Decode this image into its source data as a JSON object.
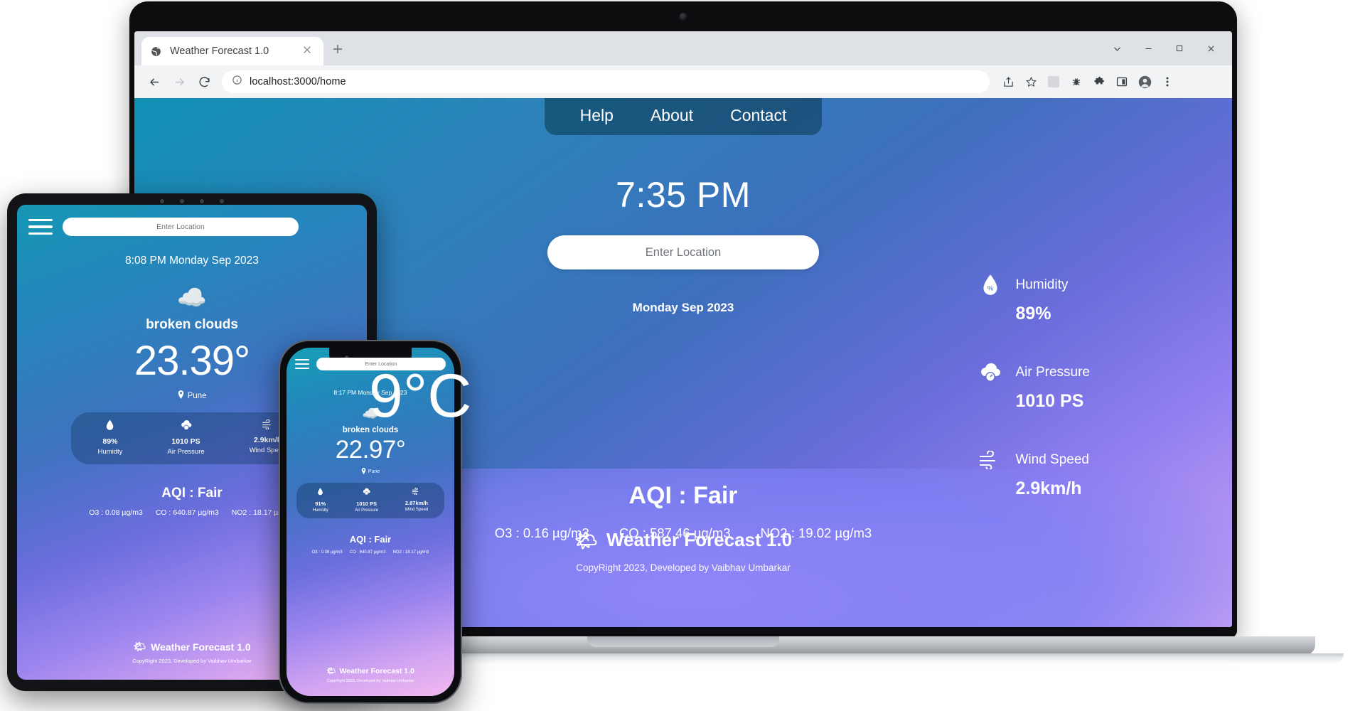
{
  "browser": {
    "tab": {
      "title": "Weather Forecast 1.0",
      "favicon": "globe-icon",
      "close": "×"
    },
    "new_tab": "+",
    "window_controls": {
      "minimize": "—",
      "maximize": "□",
      "close": "✕",
      "chevron_down": "⌄"
    },
    "nav": {
      "back": "←",
      "forward": "→",
      "reload": "⟳"
    },
    "omnibox": {
      "info_icon": "info-circle-icon",
      "url": "localhost:3000/home"
    },
    "toolbar_icons": [
      "share-icon",
      "star-icon",
      "qr-code-icon",
      "bug-icon",
      "extensions-icon",
      "split-screen-icon",
      "avatar-icon",
      "more-menu-icon"
    ]
  },
  "desktop": {
    "nav": [
      {
        "label": "Help"
      },
      {
        "label": "About"
      },
      {
        "label": "Contact"
      }
    ],
    "time": "7:35 PM",
    "search": {
      "placeholder": "Enter Location",
      "value": ""
    },
    "date": "Monday Sep 2023",
    "temperature": "9°C",
    "metrics": [
      {
        "icon": "humidity-droplet-icon",
        "label": "Humidity",
        "value": "89%"
      },
      {
        "icon": "air-pressure-cloud-gauge-icon",
        "label": "Air Pressure",
        "value": "1010 PS"
      },
      {
        "icon": "wind-speed-icon",
        "label": "Wind Speed",
        "value": "2.9km/h"
      }
    ],
    "aqi": {
      "title": "AQI : Fair",
      "pollutants": [
        "O3 : 0.16 µg/m3",
        "CO : 587.46 µg/m3",
        "NO2 : 19.02 µg/m3"
      ]
    },
    "footer": {
      "emoji": "🌤",
      "brand": "Weather Forecast 1.0",
      "copyright": "CopyRight 2023, Developed by Vaibhav Umbarkar"
    }
  },
  "tablet": {
    "menu_icon": "hamburger-menu-icon",
    "search": {
      "placeholder": "Enter Location",
      "value": ""
    },
    "datetime": "8:08 PM  Monday Sep 2023",
    "weather_icon": "broken-clouds-icon",
    "condition": "broken clouds",
    "temperature": "23.39°",
    "location": "Pune",
    "location_icon": "map-pin-icon",
    "metrics": [
      {
        "icon": "humidity-droplet-icon",
        "value": "89%",
        "label": "Humidty"
      },
      {
        "icon": "air-pressure-cloud-gauge-icon",
        "value": "1010 PS",
        "label": "Air Pressure"
      },
      {
        "icon": "wind-speed-icon",
        "value": "2.9km/h",
        "label": "Wind Speed"
      }
    ],
    "aqi": {
      "title": "AQI : Fair",
      "pollutants": [
        "O3 : 0.08 µg/m3",
        "CO : 640.87 µg/m3",
        "NO2 : 18.17 µg/m3"
      ]
    },
    "footer": {
      "emoji": "🌤",
      "brand": "Weather Forecast 1.0",
      "copyright": "CopyRight 2023, Developed by Vaibhav Umbarkar"
    }
  },
  "phone": {
    "menu_icon": "hamburger-menu-icon",
    "search": {
      "placeholder": "Enter Location",
      "value": ""
    },
    "datetime": "8:17 PM  Monday Sep 2023",
    "weather_icon": "broken-clouds-icon",
    "condition": "broken clouds",
    "temperature": "22.97°",
    "location": "Pune",
    "location_icon": "map-pin-icon",
    "metrics": [
      {
        "icon": "humidity-droplet-icon",
        "value": "91%",
        "label": "Humidty"
      },
      {
        "icon": "air-pressure-cloud-gauge-icon",
        "value": "1010 PS",
        "label": "Air Pressure"
      },
      {
        "icon": "wind-speed-icon",
        "value": "2.87km/h",
        "label": "Wind Speed"
      }
    ],
    "aqi": {
      "title": "AQI : Fair",
      "pollutants": [
        "O3 : 0.08 µg/m3",
        "CO : 640.87 µg/m3",
        "NO2 : 18.17 µg/m3"
      ]
    },
    "footer": {
      "emoji": "🌤",
      "brand": "Weather Forecast 1.0",
      "copyright": "CopyRight 2023, Developed by Vaibhav Umbarkar"
    }
  },
  "colors": {
    "gradient_start": "#1090b5",
    "gradient_mid": "#6a6ddb",
    "gradient_end": "#c9a2f2",
    "nav_pill": "rgba(8,54,76,.55)",
    "chrome_tabbar": "#dee1e6",
    "chrome_toolbar": "#f1f3f4"
  }
}
